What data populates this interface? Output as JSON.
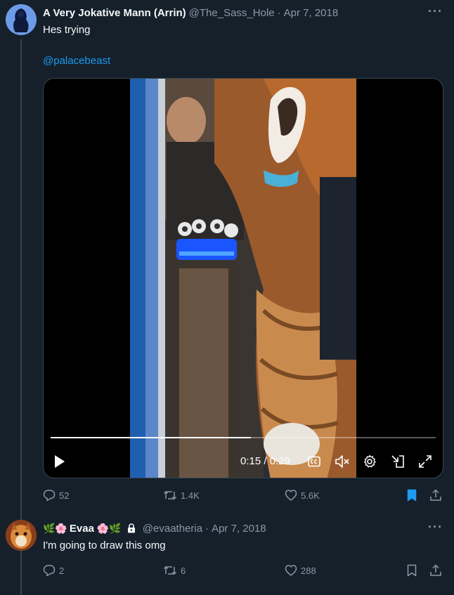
{
  "tweet": {
    "author_name": "A Very Jokative Mann (Arrin)",
    "handle": "@The_Sass_Hole",
    "separator": "·",
    "date": "Apr 7, 2018",
    "more": "···",
    "text": "Hes trying",
    "mention": "@palacebeast",
    "video": {
      "time_current": "0:15",
      "time_total": "0:29",
      "time_separator": "/",
      "progress": 0.52
    },
    "stats": {
      "replies": "52",
      "retweets": "1.4K",
      "likes": "5.6K"
    },
    "bookmarked": true
  },
  "reply": {
    "emoji_prefix": "🌿🌸",
    "author_name": "Evaa",
    "emoji_suffix": "🌸🌿",
    "locked": true,
    "handle": "@evaatheria",
    "separator": "·",
    "date": "Apr 7, 2018",
    "more": "···",
    "text": "I'm going to draw this omg",
    "stats": {
      "replies": "2",
      "retweets": "6",
      "likes": "288"
    },
    "bookmarked": false
  },
  "colors": {
    "background": "#15202b",
    "text": "#f7f9f9",
    "secondary": "#8b98a5",
    "accent": "#1d9bf0"
  }
}
